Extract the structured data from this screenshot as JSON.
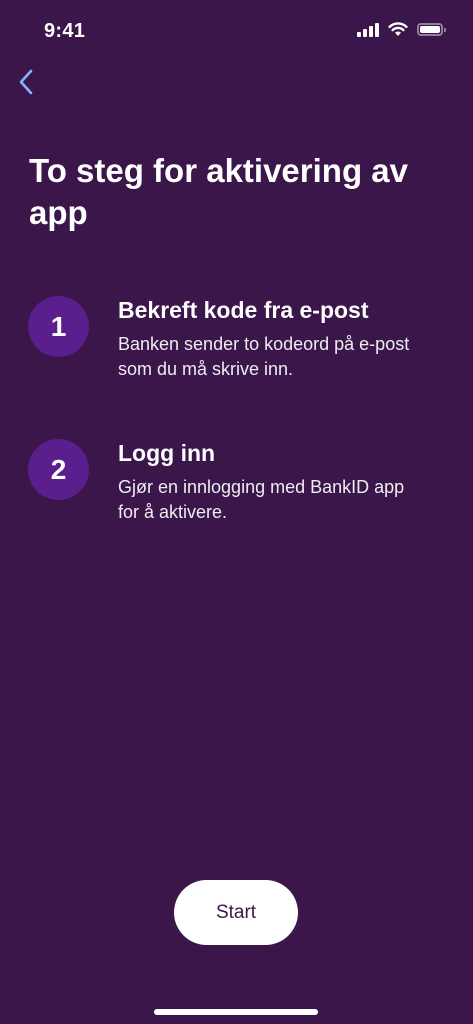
{
  "status_bar": {
    "time": "9:41"
  },
  "colors": {
    "background": "#3a164b",
    "step_circle": "#5a1e8d",
    "back_chevron": "#8ab4f8",
    "button_bg": "#ffffff",
    "button_text": "#3a164b"
  },
  "icons": {
    "back": "chevron-left-icon",
    "signal": "cellular-signal-icon",
    "wifi": "wifi-icon",
    "battery": "battery-icon"
  },
  "title": "To steg for aktivering av app",
  "steps": [
    {
      "number": "1",
      "title": "Bekreft kode fra e-post",
      "description": "Banken sender to kodeord på e-post som du må skrive inn."
    },
    {
      "number": "2",
      "title": "Logg inn",
      "description": "Gjør en innlogging med BankID app for å aktivere."
    }
  ],
  "start_button": {
    "label": "Start"
  }
}
